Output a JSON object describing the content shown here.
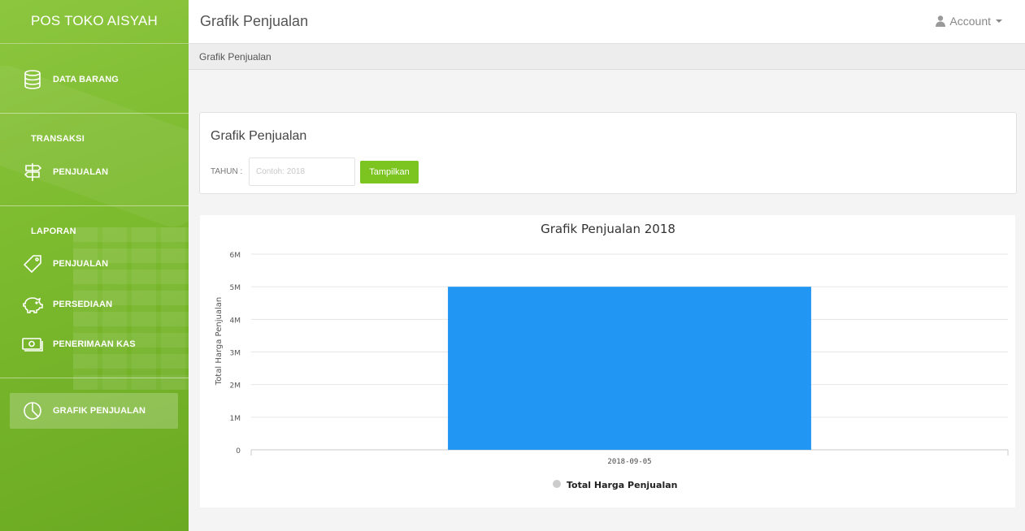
{
  "sidebar": {
    "brand": "POS TOKO AISYAH",
    "data_barang": {
      "label": "DATA BARANG",
      "icon": "database-icon"
    },
    "transaksi": {
      "title": "TRANSAKSI",
      "items": [
        {
          "label": "PENJUALAN",
          "icon": "signpost-icon"
        }
      ]
    },
    "laporan": {
      "title": "LAPORAN",
      "items": [
        {
          "label": "PENJUALAN",
          "icon": "tag-icon"
        },
        {
          "label": "PERSEDIAAN",
          "icon": "piggy-bank-icon"
        },
        {
          "label": "PENERIMAAN KAS",
          "icon": "cash-icon"
        }
      ]
    },
    "grafik": {
      "label": "GRAFIK PENJUALAN",
      "icon": "pie-chart-icon",
      "active": true
    }
  },
  "header": {
    "title": "Grafik Penjualan",
    "account_label": "Account",
    "account_icon": "user-icon"
  },
  "breadcrumb": "Grafik Penjualan",
  "filter": {
    "title": "Grafik Penjualan",
    "year_label": "TAHUN :",
    "year_value": "",
    "year_placeholder": "Contoh: 2018",
    "submit_label": "Tampilkan"
  },
  "colors": {
    "sidebar": "#7dbb2f",
    "button": "#7cc41f",
    "bar": "#2196f3"
  },
  "chart_data": {
    "type": "bar",
    "title": "Grafik Penjualan 2018",
    "categories": [
      "2018-09-05"
    ],
    "series": [
      {
        "name": "Total Harga Penjualan",
        "values": [
          5000000
        ]
      }
    ],
    "ylabel": "Total Harga Penjualan",
    "xlabel": "",
    "ylim": [
      0,
      6000000
    ],
    "yticks": [
      "0",
      "1M",
      "2M",
      "3M",
      "4M",
      "5M",
      "6M"
    ],
    "grid": true,
    "legend": "bottom"
  }
}
